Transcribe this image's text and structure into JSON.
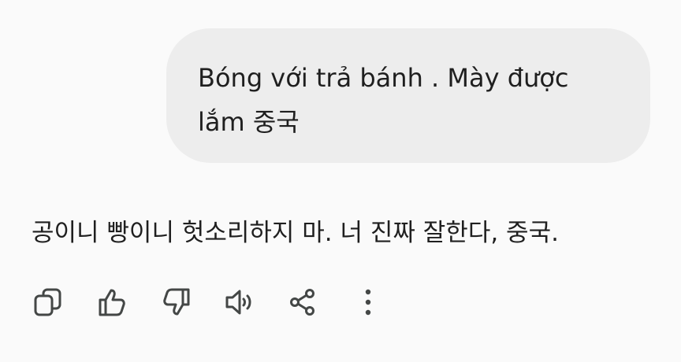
{
  "user_message": {
    "text": "Bóng với trả bánh . Mày được lắm 중국"
  },
  "model_response": {
    "text": "공이니 빵이니 헛소리하지 마. 너 진짜 잘한다, 중국."
  },
  "actions": {
    "icons": [
      "copy-icon",
      "thumbs-up-icon",
      "thumbs-down-icon",
      "speaker-icon",
      "share-icon",
      "more-vert-icon"
    ],
    "icon_color": "#444746"
  }
}
